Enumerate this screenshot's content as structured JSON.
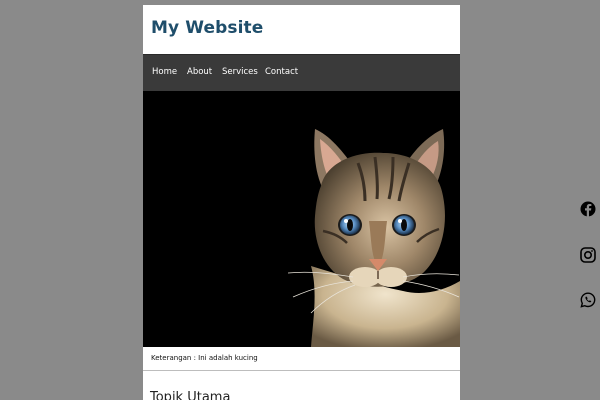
{
  "header": {
    "site_title": "My Website"
  },
  "nav": {
    "items": [
      {
        "label": "Home"
      },
      {
        "label": "About"
      },
      {
        "label": "Services"
      },
      {
        "label": "Contact"
      }
    ]
  },
  "hero": {
    "image": "cat-photo",
    "caption": "Keterangan : Ini adalah kucing"
  },
  "content": {
    "heading": "Topik Utama"
  },
  "social": {
    "icons": [
      "facebook-icon",
      "instagram-icon",
      "whatsapp-icon"
    ]
  },
  "colors": {
    "page_background": "#8a8a8a",
    "card_background": "#ffffff",
    "title_color": "#1f4e6b",
    "nav_background": "#3a3a3a",
    "nav_text": "#ffffff"
  }
}
